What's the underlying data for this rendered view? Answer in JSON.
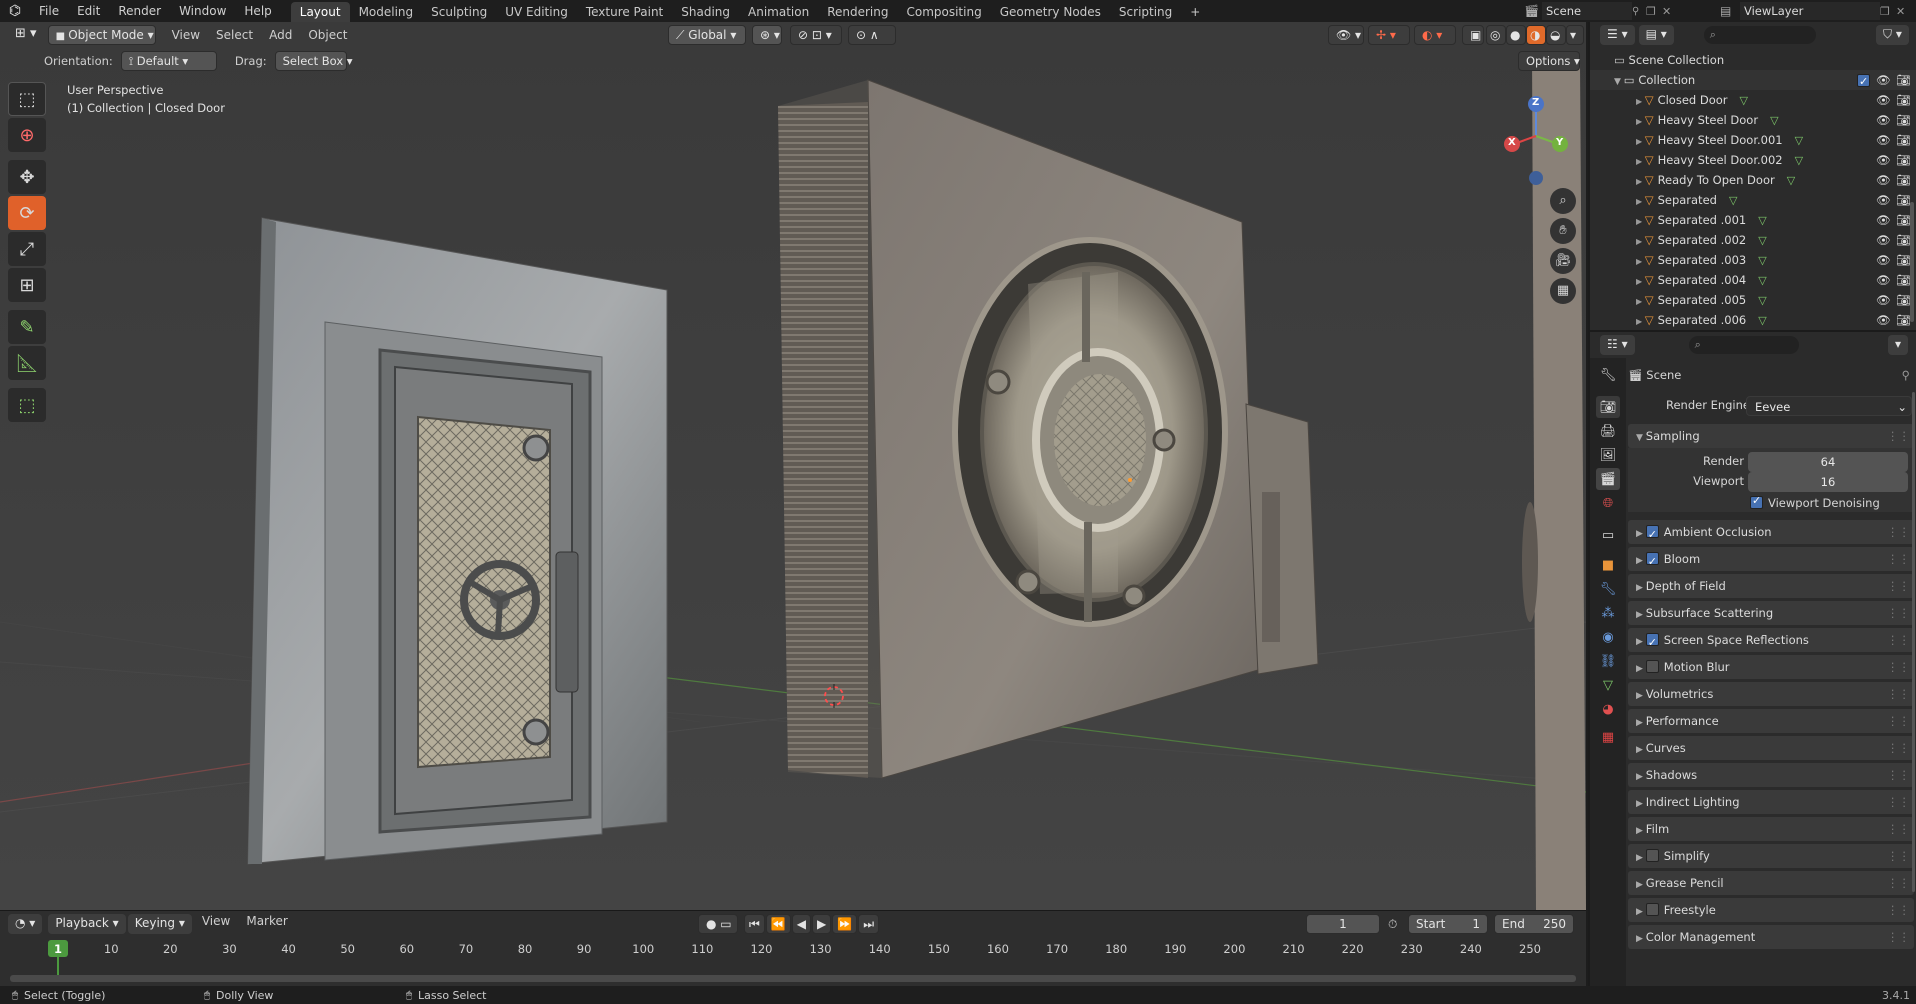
{
  "topbar": {
    "menus": [
      "File",
      "Edit",
      "Render",
      "Window",
      "Help"
    ],
    "workspaces": [
      "Layout",
      "Modeling",
      "Sculpting",
      "UV Editing",
      "Texture Paint",
      "Shading",
      "Animation",
      "Rendering",
      "Compositing",
      "Geometry Nodes",
      "Scripting"
    ],
    "active_workspace": "Layout",
    "add_tab": "+",
    "scene_name": "Scene",
    "view_layer": "ViewLayer"
  },
  "viewport": {
    "mode": "Object Mode",
    "menus": [
      "View",
      "Select",
      "Add",
      "Object"
    ],
    "transform_orientation": "Global",
    "orientation_label": "Orientation:",
    "orientation_value": "Default",
    "drag_label": "Drag:",
    "drag_value": "Select Box",
    "options_label": "Options",
    "perspective_text": "User Perspective",
    "collection_text": "(1) Collection | Closed Door",
    "gizmo": {
      "x": "X",
      "y": "Y",
      "z": "Z"
    }
  },
  "toolbar": [
    "select-box",
    "cursor",
    "move",
    "rotate",
    "scale",
    "transform",
    "annotate",
    "measure",
    "add-cube"
  ],
  "timeline": {
    "menus": [
      "Playback",
      "Keying",
      "View",
      "Marker"
    ],
    "current_frame": "1",
    "start_label": "Start",
    "start_value": "1",
    "end_label": "End",
    "end_value": "250",
    "ruler": [
      "1",
      "10",
      "20",
      "30",
      "40",
      "50",
      "60",
      "70",
      "80",
      "90",
      "100",
      "110",
      "120",
      "130",
      "140",
      "150",
      "160",
      "170",
      "180",
      "190",
      "200",
      "210",
      "220",
      "230",
      "240",
      "250"
    ]
  },
  "statusbar": {
    "select": "Select (Toggle)",
    "dolly": "Dolly View",
    "lasso": "Lasso Select",
    "version": "3.4.1"
  },
  "outliner": {
    "scene_collection": "Scene Collection",
    "collection": "Collection",
    "objects": [
      "Closed Door",
      "Heavy Steel Door",
      "Heavy Steel Door.001",
      "Heavy Steel Door.002",
      "Ready To Open Door",
      "Separated",
      "Separated .001",
      "Separated .002",
      "Separated .003",
      "Separated .004",
      "Separated .005",
      "Separated .006"
    ]
  },
  "properties": {
    "context": "Scene",
    "render_engine_label": "Render Engine",
    "render_engine": "Eevee",
    "sampling": "Sampling",
    "render_label": "Render",
    "render_samples": "64",
    "viewport_label": "Viewport",
    "viewport_samples": "16",
    "viewport_denoising": "Viewport Denoising",
    "panels": [
      {
        "label": "Ambient Occlusion",
        "checkbox": true,
        "checked": true
      },
      {
        "label": "Bloom",
        "checkbox": true,
        "checked": true
      },
      {
        "label": "Depth of Field",
        "checkbox": false,
        "checked": false
      },
      {
        "label": "Subsurface Scattering",
        "checkbox": false,
        "checked": false
      },
      {
        "label": "Screen Space Reflections",
        "checkbox": true,
        "checked": true
      },
      {
        "label": "Motion Blur",
        "checkbox": true,
        "checked": false
      },
      {
        "label": "Volumetrics",
        "checkbox": false,
        "checked": false
      },
      {
        "label": "Performance",
        "checkbox": false,
        "checked": false
      },
      {
        "label": "Curves",
        "checkbox": false,
        "checked": false
      },
      {
        "label": "Shadows",
        "checkbox": false,
        "checked": false
      },
      {
        "label": "Indirect Lighting",
        "checkbox": false,
        "checked": false
      },
      {
        "label": "Film",
        "checkbox": false,
        "checked": false
      },
      {
        "label": "Simplify",
        "checkbox": true,
        "checked": false
      },
      {
        "label": "Grease Pencil",
        "checkbox": false,
        "checked": false
      },
      {
        "label": "Freestyle",
        "checkbox": true,
        "checked": false
      },
      {
        "label": "Color Management",
        "checkbox": false,
        "checked": false
      }
    ]
  },
  "colors": {
    "accent": "#4772b3",
    "frame_marker": "#4c9a3f",
    "mesh_icon": "#e8943a"
  }
}
